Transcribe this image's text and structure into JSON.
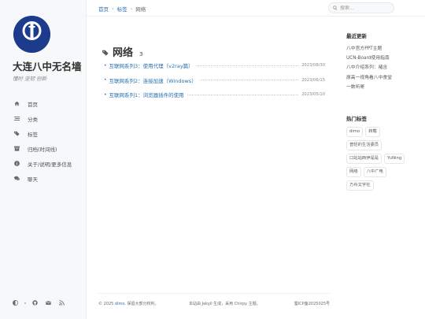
{
  "site": {
    "title": "大连八中无名墙",
    "subtitle": "懂时 坚韧 创新",
    "avatar_text": "大连市第八中"
  },
  "nav": [
    {
      "label": "首页",
      "icon": "home-icon"
    },
    {
      "label": "分类",
      "icon": "stream-icon"
    },
    {
      "label": "标签",
      "icon": "tags-icon"
    },
    {
      "label": "归档(时间线)",
      "icon": "archive-icon"
    },
    {
      "label": "关于/说明/更多信息",
      "icon": "info-icon"
    },
    {
      "label": "聊天",
      "icon": "comments-icon"
    }
  ],
  "breadcrumb": {
    "home": "首页",
    "tags": "标签",
    "current": "网络"
  },
  "search": {
    "placeholder": "搜索..."
  },
  "page": {
    "heading": "网络",
    "count": "3"
  },
  "posts": [
    {
      "title": "互联网系列3：使用代理（v2ray篇）",
      "date": "2023/08/30"
    },
    {
      "title": "互联网系列2：连接加速（Windows）",
      "date": "2023/06/15"
    },
    {
      "title": "互联网系列1：浏览器插件的使用",
      "date": "2023/05/10"
    }
  ],
  "panel": {
    "recent_title": "最近更新",
    "recent": [
      "八中官方PPT主题",
      "UCN-Board使用指南",
      "八中介绍系列：褚含",
      "原高一视角看八中食堂",
      "一数听哥"
    ],
    "tags_title": "热门标签",
    "tags": [
      "dimo",
      "转载",
      "普轻的生活委员",
      "口站站西伊是是",
      "YuNing",
      "网络",
      "八中广电",
      "方舟文字社"
    ]
  },
  "footer": {
    "copyright_prefix": "© 2025 ",
    "author": "dimo",
    "copyright_suffix": ". 保留大部分权利。",
    "powered": "本站由 Jekyll 生成，采用 Chirpy 主题。",
    "icp": "蜀ICP备2025025号"
  },
  "colors": {
    "accent": "#2a6fb0",
    "sidebar_bg": "#f6f8fa",
    "avatar_bg": "#1d3b8c"
  }
}
